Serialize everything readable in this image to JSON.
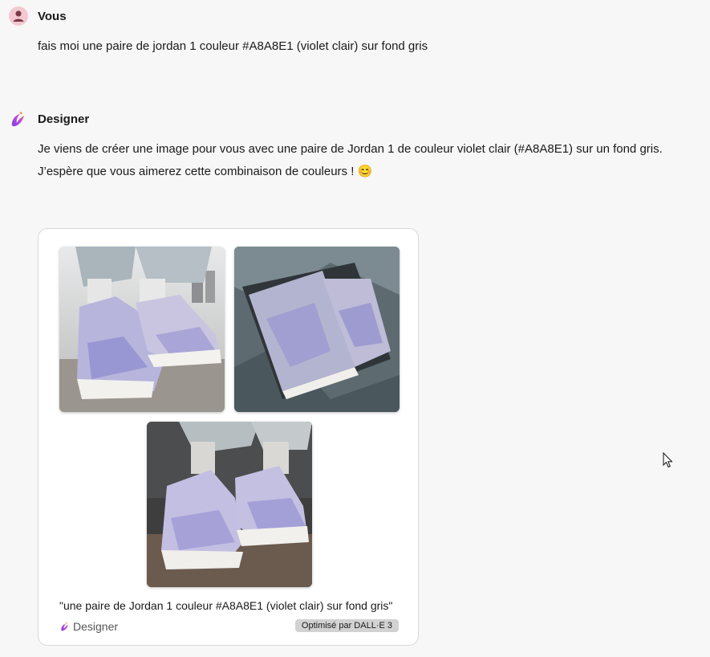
{
  "user_message": {
    "author": "Vous",
    "text": "fais moi une paire de jordan 1 couleur #A8A8E1 (violet clair) sur fond gris"
  },
  "bot_message": {
    "author": "Designer",
    "text_line1": "Je viens de créer une image pour vous avec une paire de Jordan 1 de couleur violet clair (#A8A8E1) sur un fond gris.",
    "text_line2": "J’espère que vous aimerez cette combinaison de couleurs !",
    "emoji": "😊"
  },
  "image_card": {
    "caption": "\"une paire de Jordan 1 couleur #A8A8E1 (violet clair) sur fond gris\"",
    "brand_label": "Designer",
    "badge": "Optimisé par DALL·E 3",
    "images": [
      "generated-image-1",
      "generated-image-2",
      "generated-image-3"
    ]
  },
  "colors": {
    "background": "#f7f7f7",
    "card": "#ffffff",
    "sneaker_violet": "#A8A8E1",
    "avatar_bg": "#f3c9cf"
  },
  "icons": [
    "user-avatar-icon",
    "designer-logo-icon",
    "mouse-cursor-icon"
  ]
}
